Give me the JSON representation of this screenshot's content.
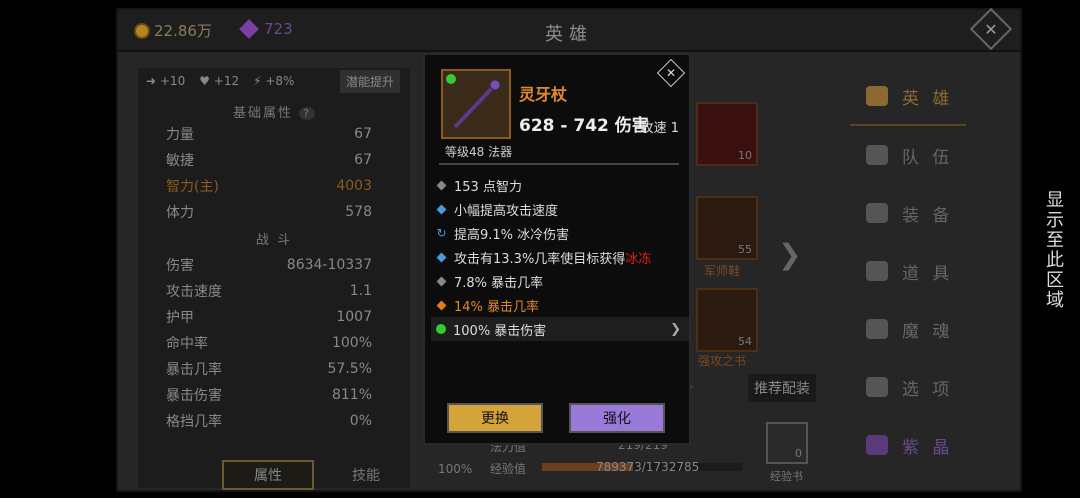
{
  "header": {
    "gold": "22.86万",
    "gems": "723",
    "title": "英雄"
  },
  "left": {
    "buffs": [
      "+10",
      "+12",
      "+8%"
    ],
    "potential_btn": "潜能提升",
    "base_title": "基础属性",
    "base_q": "?",
    "base": [
      {
        "k": "力量",
        "v": "67"
      },
      {
        "k": "敏捷",
        "v": "67"
      },
      {
        "k": "智力(主)",
        "v": "4003"
      },
      {
        "k": "体力",
        "v": "578"
      }
    ],
    "combat_title": "战 斗",
    "combat": [
      {
        "k": "伤害",
        "v": "8634-10337"
      },
      {
        "k": "攻击速度",
        "v": "1.1"
      },
      {
        "k": "护甲",
        "v": "1007"
      },
      {
        "k": "命中率",
        "v": "100%"
      },
      {
        "k": "暴击几率",
        "v": "57.5%"
      },
      {
        "k": "暴击伤害",
        "v": "811%"
      },
      {
        "k": "格挡几率",
        "v": "0%"
      }
    ],
    "tab_attr": "属性",
    "tab_skill": "技能"
  },
  "menu": [
    {
      "icon": "hero-icon",
      "label": "英 雄"
    },
    {
      "icon": "flag-icon",
      "label": "队 伍"
    },
    {
      "icon": "helmet-icon",
      "label": "装 备"
    },
    {
      "icon": "bag-icon",
      "label": "道 具"
    },
    {
      "icon": "flame-icon",
      "label": "魔 魂"
    },
    {
      "icon": "gear-icon",
      "label": "选 项"
    },
    {
      "icon": "crystal-icon",
      "label": "紫 晶"
    }
  ],
  "bg_items": {
    "helmet_level": "10",
    "boots_num": "55",
    "boots_label": "军师鞋",
    "book_num": "54",
    "book_label": "强攻之书",
    "recommend": "推荐配装",
    "exp_book_num": "0",
    "exp_book_label": "经验书",
    "mana_label": "法力值",
    "mana_value": "219/219",
    "exp_label": "经验值",
    "exp_value": "789373/1732785",
    "pct": "100%",
    "exp_ratio": 0.456,
    "hint_num": "67"
  },
  "side_text": "显示至此区域",
  "popup": {
    "name": "灵牙杖",
    "damage": "628 - 742 伤害",
    "speed": "攻速 1",
    "level": "等级48 法器",
    "attrs": [
      {
        "b": "gray",
        "t": "153 点智力"
      },
      {
        "b": "blue",
        "t": "小幅提高攻击速度"
      },
      {
        "b": "cycle",
        "t": "提高9.1% 冰冷伤害"
      },
      {
        "b": "blue",
        "t": "攻击有13.3%几率使目标获得",
        "extra": "冰冻"
      },
      {
        "b": "gray",
        "t": "7.8% 暴击几率"
      },
      {
        "b": "orange",
        "t": "14% 暴击几率"
      },
      {
        "b": "gem",
        "t": "100% 暴击伤害"
      }
    ],
    "btn_replace": "更换",
    "btn_enhance": "强化"
  },
  "colors": {
    "accent": "#8a6a30",
    "gold_btn": "#d4a43a",
    "purple_btn": "#9a7ad8",
    "freeze": "#e02020"
  }
}
